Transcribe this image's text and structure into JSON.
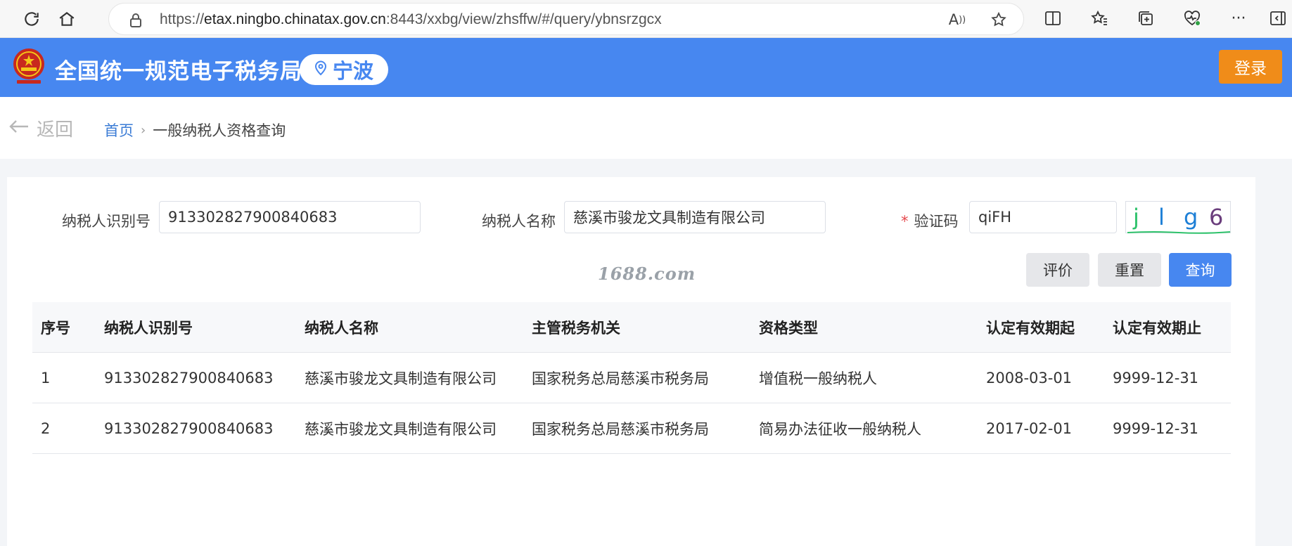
{
  "browser": {
    "url_prefix": "https://",
    "url_host": "etax.ningbo.chinatax.gov.cn",
    "url_rest": ":8443/xxbg/view/zhsffw/#/query/ybnsrzgcx"
  },
  "header": {
    "title": "全国统一规范电子税务局",
    "city": "宁波",
    "login_label": "登录"
  },
  "breadcrumb": {
    "back_label": "返回",
    "home": "首页",
    "current": "一般纳税人资格查询"
  },
  "form": {
    "taxpayer_id_label": "纳税人识别号",
    "taxpayer_id_value": "913302827900840683",
    "taxpayer_name_label": "纳税人名称",
    "taxpayer_name_value": "慈溪市骏龙文具制造有限公司",
    "captcha_required_mark": "*",
    "captcha_label": "验证码",
    "captcha_value": "qiFH",
    "captcha_chars": [
      "j",
      "l",
      "g",
      "6"
    ],
    "captcha_colors": [
      "#2ec26b",
      "#1d7fd6",
      "#1d7fd6",
      "#6a3d7c"
    ]
  },
  "buttons": {
    "evaluate": "评价",
    "reset": "重置",
    "query": "查询"
  },
  "watermark": "1688.com",
  "table": {
    "headers": [
      "序号",
      "纳税人识别号",
      "纳税人名称",
      "主管税务机关",
      "资格类型",
      "认定有效期起",
      "认定有效期止"
    ],
    "rows": [
      [
        "1",
        "913302827900840683",
        "慈溪市骏龙文具制造有限公司",
        "国家税务总局慈溪市税务局",
        "增值税一般纳税人",
        "2008-03-01",
        "9999-12-31"
      ],
      [
        "2",
        "913302827900840683",
        "慈溪市骏龙文具制造有限公司",
        "国家税务总局慈溪市税务局",
        "简易办法征收一般纳税人",
        "2017-02-01",
        "9999-12-31"
      ]
    ]
  },
  "colors": {
    "header_blue": "#4787f0",
    "login_orange": "#f08c19",
    "link_blue": "#3a7bd5"
  }
}
